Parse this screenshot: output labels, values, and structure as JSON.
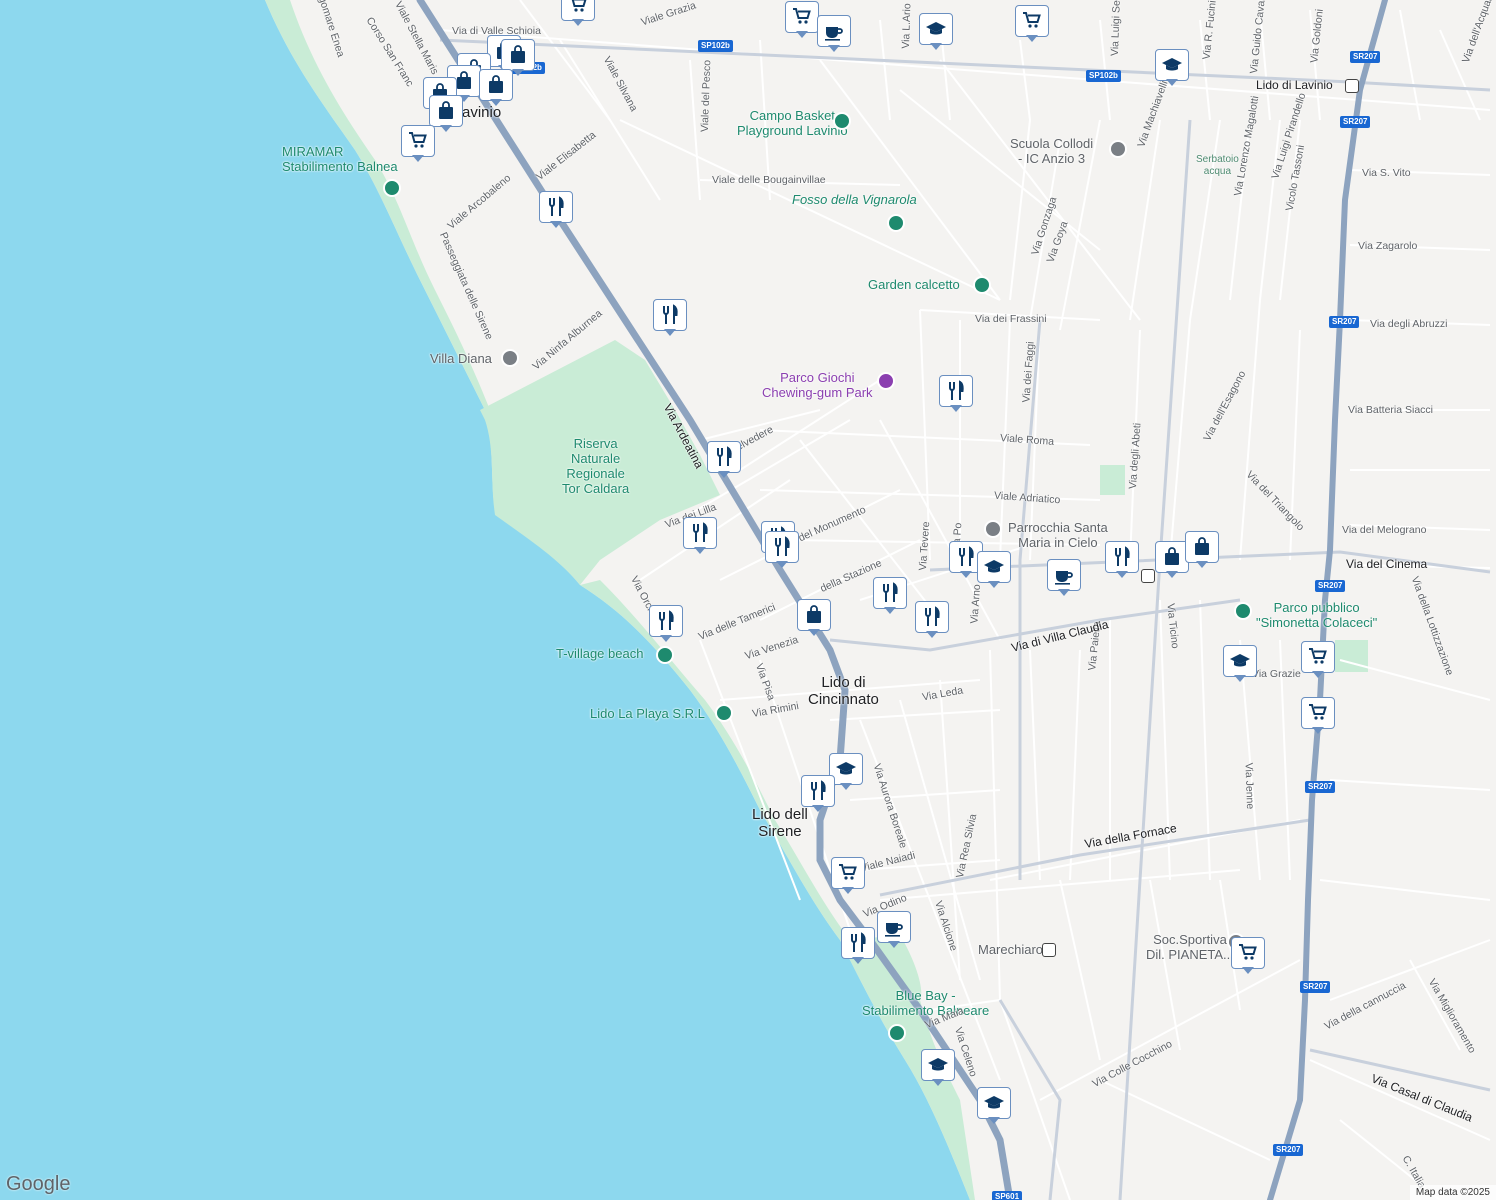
{
  "map": {
    "attribution": "Map data ©2025",
    "logo": "Google",
    "colors": {
      "sea": "#8dd8ee",
      "land": "#f4f3f1",
      "park": "#c9ecd6",
      "main_road": "#8da3bf",
      "highway": "#8da3bf",
      "street": "#ffffff",
      "marker_icon": "#0d3a66"
    },
    "places": [
      {
        "id": "lido-di-cincinnato",
        "text": "Lido di\nCincinnato",
        "kind": "town"
      },
      {
        "id": "lido-delle-sirene",
        "text": "Lido dell\nSirene",
        "kind": "town"
      },
      {
        "id": "lido-di-lavinio",
        "text": "Lido di Lavinio",
        "kind": "road"
      },
      {
        "id": "lavinio-frag",
        "text": "avinio",
        "kind": "town"
      },
      {
        "id": "miramare",
        "text": "MIRAMAR\nStabilimento Balnea",
        "kind": "poi"
      },
      {
        "id": "campo-basket",
        "text": "Campo Basket\nPlayground Lavinio",
        "kind": "poi"
      },
      {
        "id": "scuola-collodi",
        "text": "Scuola Collodi\n- IC Anzio 3",
        "kind": "poi-grey"
      },
      {
        "id": "serbatoio",
        "text": "Serbatoio\nacqua",
        "kind": "small"
      },
      {
        "id": "fosso",
        "text": "Fosso della Vignarola",
        "kind": "poi"
      },
      {
        "id": "garden-calcetto",
        "text": "Garden calcetto",
        "kind": "poi"
      },
      {
        "id": "parco-giochi",
        "text": "Parco Giochi\nChewing-gum Park",
        "kind": "poi-purple"
      },
      {
        "id": "villa-diana",
        "text": "Villa Diana",
        "kind": "poi-grey"
      },
      {
        "id": "riserva",
        "text": "Riserva\nNaturale\nRegionale\nTor Caldara",
        "kind": "poi"
      },
      {
        "id": "parrocchia",
        "text": "Parrocchia Santa\nMaria in Cielo",
        "kind": "poi-grey"
      },
      {
        "id": "parco-pubblico",
        "text": "Parco pubblico\n\"Simonetta Colaceci\"",
        "kind": "poi"
      },
      {
        "id": "t-village",
        "text": "T-village beach",
        "kind": "poi"
      },
      {
        "id": "lido-la-playa",
        "text": "Lido La Playa S.R.L",
        "kind": "poi"
      },
      {
        "id": "marechiaro",
        "text": "Marechiaro",
        "kind": "poi-grey"
      },
      {
        "id": "soc-sportiva",
        "text": "Soc.Sportiva\nDil. PIANETA...",
        "kind": "poi-grey"
      },
      {
        "id": "blue-bay",
        "text": "Blue Bay -\nStabilimento Balneare",
        "kind": "poi"
      }
    ],
    "streets": [
      "Via di Valle Schioia",
      "Viale Grazia",
      "Viale Silvana",
      "Viale del Pesco",
      "Via L.Ario",
      "Via Luigi Setti",
      "Via R. Fucini",
      "Via Guido Caval",
      "Via Goldoni",
      "Via dell'Acquario",
      "Viale Stella Maris",
      "Corso San Franc",
      "ngomare Enea",
      "Viale Elisabetta",
      "Viale Arcobaleno",
      "Viale delle Bougainvillae",
      "Via Machiavelli",
      "Via Lorenzo Magalotti",
      "Via Luigi Pirandello",
      "Vicolo Tassoni",
      "Via S. Vito",
      "Via Zagarolo",
      "Via Gonzaga",
      "Via Goya",
      "Via dei Frassini",
      "Via degli Abruzzi",
      "Passeggiata delle Sirene",
      "Via Ninfa Alburnea",
      "Via Ardeatina",
      "Viale Roma",
      "Via Batteria Siacci",
      "Via dei Faggi",
      "Via degli Abeti",
      "Via dell'Esagono",
      "Via del Triangolo",
      "Viale Adriatico",
      "Via del Melograno",
      "Via del Cinema",
      "Via della Lottizzazione",
      "Via dei Lilla",
      "Via Tevere",
      "Via Po",
      "Via Arno",
      "Via Paiella",
      "Via Ticino",
      "Via Orchi",
      "Via delle Tamerici",
      "Via Venezia",
      "Via di Villa Claudia",
      "Via Pisa",
      "Via Rimini",
      "Via Leda",
      "Via Aurora Boreale",
      "Via Rea Silvia",
      "Via Alcione",
      "Via Jenne",
      "Via della Fornace",
      "Via Odino",
      "Viale Naiadi",
      "Via Maia",
      "Via Celeno",
      "Via Colle Cocchino",
      "Via della cannuccia",
      "Via Miglioramento",
      "Via Casal di Claudia",
      "C. Italia",
      "Belvedere",
      "della Stazione",
      "del Monumento",
      "Via Grazie"
    ],
    "road_shields": [
      "SP102b",
      "SP102b",
      "SP102b",
      "SR207",
      "SR207",
      "SR207",
      "SR207",
      "SR207",
      "SR207",
      "SR207",
      "SP601"
    ],
    "markers": [
      {
        "type": "shopping-cart"
      },
      {
        "type": "shopping-cart"
      },
      {
        "type": "coffee-cup"
      },
      {
        "type": "graduation-cap"
      },
      {
        "type": "shopping-cart"
      },
      {
        "type": "shopping-bag"
      },
      {
        "type": "shopping-bag"
      },
      {
        "type": "shopping-bag"
      },
      {
        "type": "shopping-bag"
      },
      {
        "type": "shopping-bag"
      },
      {
        "type": "shopping-bag"
      },
      {
        "type": "shopping-bag"
      },
      {
        "type": "shopping-cart"
      },
      {
        "type": "graduation-cap"
      },
      {
        "type": "fork-knife"
      },
      {
        "type": "fork-knife"
      },
      {
        "type": "fork-knife"
      },
      {
        "type": "fork-knife"
      },
      {
        "type": "fork-knife"
      },
      {
        "type": "fork-knife"
      },
      {
        "type": "fork-knife"
      },
      {
        "type": "fork-knife"
      },
      {
        "type": "shopping-bag"
      },
      {
        "type": "fork-knife"
      },
      {
        "type": "fork-knife"
      },
      {
        "type": "fork-knife"
      },
      {
        "type": "graduation-cap"
      },
      {
        "type": "coffee-cup"
      },
      {
        "type": "fork-knife"
      },
      {
        "type": "shopping-bag"
      },
      {
        "type": "shopping-bag"
      },
      {
        "type": "graduation-cap"
      },
      {
        "type": "shopping-cart"
      },
      {
        "type": "shopping-cart"
      },
      {
        "type": "graduation-cap"
      },
      {
        "type": "fork-knife"
      },
      {
        "type": "shopping-cart"
      },
      {
        "type": "coffee-cup"
      },
      {
        "type": "fork-knife"
      },
      {
        "type": "shopping-cart"
      },
      {
        "type": "graduation-cap"
      },
      {
        "type": "graduation-cap"
      }
    ]
  }
}
